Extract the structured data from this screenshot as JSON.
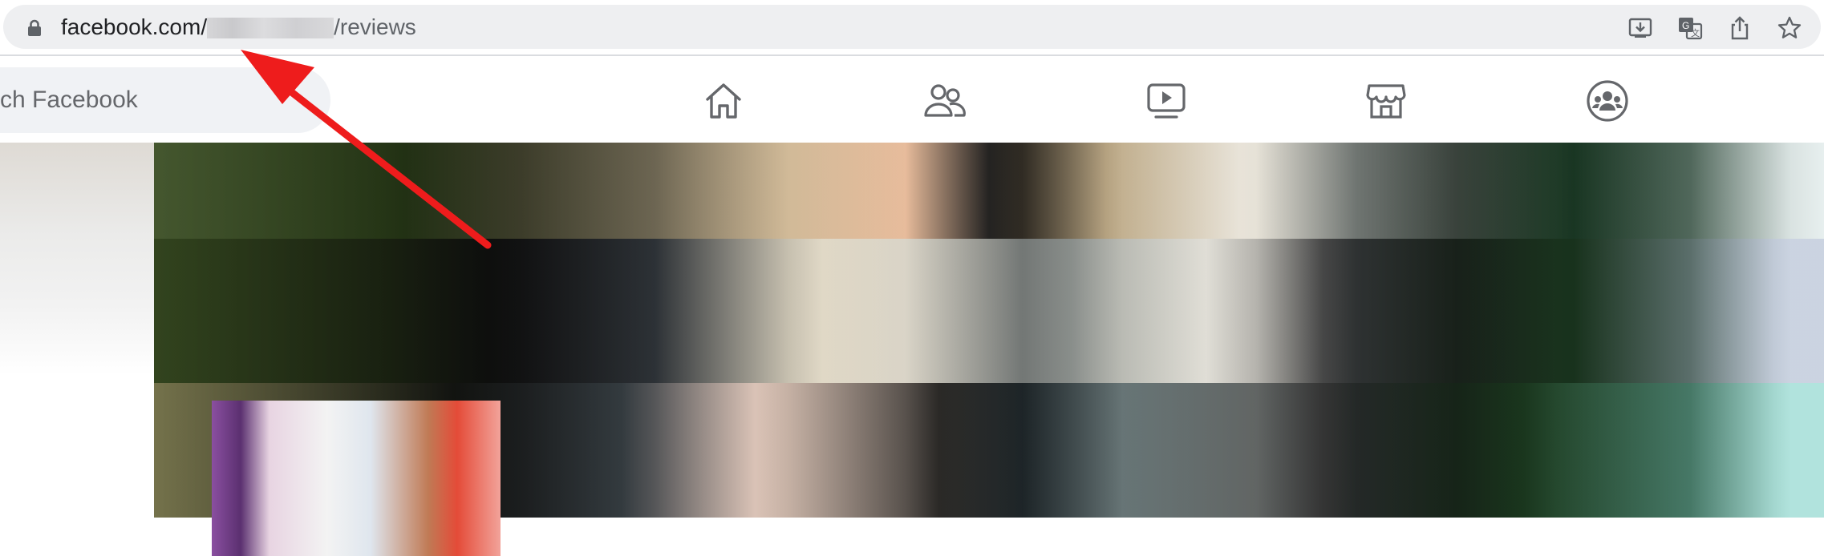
{
  "browser": {
    "url_host": "facebook.com/",
    "url_path": "/reviews",
    "actions": [
      {
        "name": "download-icon"
      },
      {
        "name": "translate-icon"
      },
      {
        "name": "share-icon"
      },
      {
        "name": "star-icon"
      }
    ]
  },
  "header": {
    "search_text": "ch Facebook",
    "nav_tabs": [
      {
        "name": "home-icon"
      },
      {
        "name": "friends-icon"
      },
      {
        "name": "watch-icon"
      },
      {
        "name": "marketplace-icon"
      },
      {
        "name": "groups-icon"
      }
    ]
  },
  "colors": {
    "annotation_arrow": "#ee1c1c",
    "nav_icon": "#65676b"
  }
}
